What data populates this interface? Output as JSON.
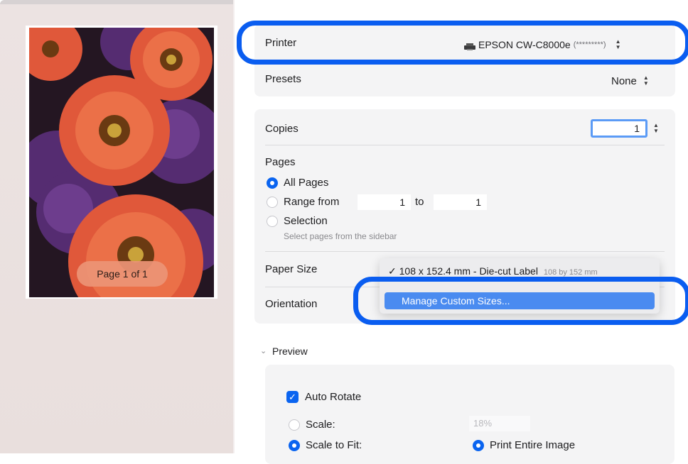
{
  "preview": {
    "page_indicator": "Page 1 of 1"
  },
  "printer": {
    "label": "Printer",
    "value_name": "EPSON CW-C8000e",
    "value_suffix": "(*********)"
  },
  "presets": {
    "label": "Presets",
    "value": "None"
  },
  "copies": {
    "label": "Copies",
    "value": "1"
  },
  "pages": {
    "label": "Pages",
    "all_pages": "All Pages",
    "range_from_label": "Range from",
    "range_from": "1",
    "to_label": "to",
    "range_to": "1",
    "selection_label": "Selection",
    "selection_hint": "Select pages from the sidebar"
  },
  "paper_size": {
    "label": "Paper Size",
    "menu_selected": "✓ 108 x 152.4 mm - Die-cut Label",
    "menu_selected_detail": "108 by 152 mm",
    "menu_manage": "Manage Custom Sizes..."
  },
  "orientation": {
    "label": "Orientation"
  },
  "preview_section": {
    "label": "Preview",
    "auto_rotate": "Auto Rotate",
    "scale_label": "Scale:",
    "scale_value": "18%",
    "scale_to_fit": "Scale to Fit:",
    "print_entire_image": "Print Entire Image"
  },
  "colors": {
    "accent": "#0a5df0",
    "menu_highlight": "#4a8bf0"
  }
}
